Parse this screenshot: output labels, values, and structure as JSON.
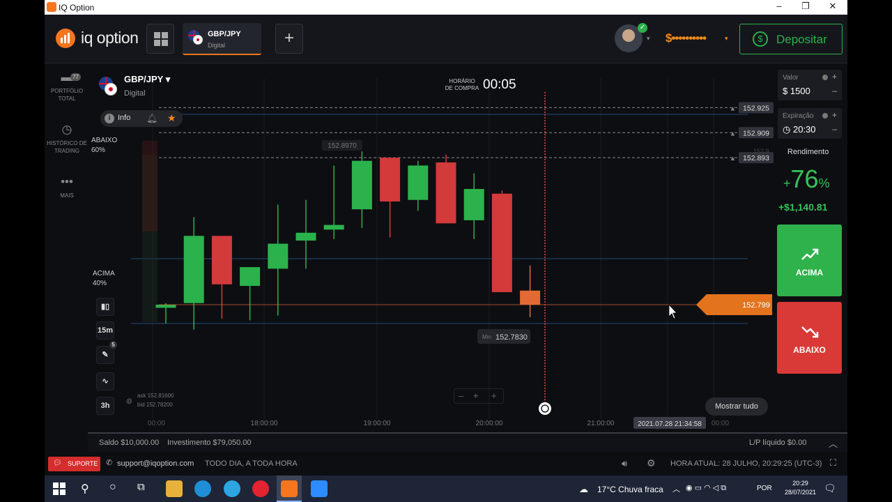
{
  "window": {
    "title": "IQ Option",
    "buttons": [
      "–",
      "❐",
      "✕"
    ]
  },
  "header": {
    "brand": "iq option",
    "asset_tab": {
      "name": "GBP/JPY",
      "type": "Digital"
    },
    "add_label": "+",
    "balance_masked": "$••••••••••",
    "deposit_label": "Depositar",
    "brand_color": "#f4761f",
    "accent_green": "#2bb24c"
  },
  "sidebar": {
    "items": [
      {
        "icon": "briefcase-icon",
        "label": "PORTFÓLIO TOTAL",
        "badge": "77"
      },
      {
        "icon": "history-icon",
        "label": "HISTÓRICO DE TRADING"
      },
      {
        "icon": "more-icon",
        "label": "MAIS"
      }
    ]
  },
  "chart_header": {
    "asset": "GBP/JPY",
    "type": "Digital",
    "info_label": "Info",
    "purchase_time_label": "HORÁRIO DE COMPRA",
    "purchase_timer": "00:05"
  },
  "sentiment": {
    "below_label": "ABAIXO",
    "below_pct": "60%",
    "above_label": "ACIMA",
    "above_pct": "40%"
  },
  "tools": {
    "timeframe": "15m",
    "pencil_badge": "5",
    "period": "3h"
  },
  "quotes": {
    "ask": "ask 152.81600",
    "bid": "bid 152.78200"
  },
  "chart_data": {
    "type": "candlestick",
    "x_ticks": [
      "18:00:00",
      "19:00:00",
      "20:00:00",
      "21:00:00",
      "2021.07.28 21:34:58"
    ],
    "x_edge_labels": [
      "00:00",
      "00:00"
    ],
    "ylim": [
      152.77,
      152.935
    ],
    "strike_levels": [
      152.925,
      152.909,
      152.893
    ],
    "current_price": "152.799",
    "max_label": "152.8970",
    "min_label_prefix": "Min",
    "min_label": "152.7830",
    "faded_level": "152.9",
    "candles": [
      {
        "o": 152.797,
        "h": 152.8,
        "l": 152.787,
        "c": 152.799
      },
      {
        "o": 152.8,
        "h": 152.855,
        "l": 152.783,
        "c": 152.843
      },
      {
        "o": 152.843,
        "h": 152.843,
        "l": 152.79,
        "c": 152.812
      },
      {
        "o": 152.811,
        "h": 152.823,
        "l": 152.789,
        "c": 152.823
      },
      {
        "o": 152.822,
        "h": 152.863,
        "l": 152.792,
        "c": 152.838
      },
      {
        "o": 152.84,
        "h": 152.866,
        "l": 152.822,
        "c": 152.845
      },
      {
        "o": 152.847,
        "h": 152.888,
        "l": 152.841,
        "c": 152.85
      },
      {
        "o": 152.86,
        "h": 152.897,
        "l": 152.848,
        "c": 152.891
      },
      {
        "o": 152.893,
        "h": 152.893,
        "l": 152.842,
        "c": 152.865
      },
      {
        "o": 152.866,
        "h": 152.891,
        "l": 152.859,
        "c": 152.888
      },
      {
        "o": 152.89,
        "h": 152.895,
        "l": 152.852,
        "c": 152.851
      },
      {
        "o": 152.853,
        "h": 152.883,
        "l": 152.841,
        "c": 152.873
      },
      {
        "o": 152.87,
        "h": 152.872,
        "l": 152.809,
        "c": 152.807
      },
      {
        "o": 152.808,
        "h": 152.824,
        "l": 152.791,
        "c": 152.799
      }
    ],
    "grid": true,
    "up_color": "#2bb24c",
    "down_color": "#d33a3a"
  },
  "chart_controls": {
    "zoom_out": "–",
    "zoom_in": "+",
    "show_all": "Mostrar tudo"
  },
  "trade_panel": {
    "value_label": "Valor",
    "value": "$ 1500",
    "expiry_label": "Expiração",
    "expiry": "20:30",
    "yield_label": "Rendimento",
    "yield_sign": "+",
    "yield_value": "76",
    "yield_pct": "%",
    "profit": "+$1,140.81",
    "up_label": "ACIMA",
    "down_label": "ABAIXO"
  },
  "footer": {
    "saldo": "Saldo $10,000.00",
    "investimento": "Investimento $79,050.00",
    "pl": "L/P líquido $0.00",
    "support_btn": "SUPORTE",
    "support_email": "support@iqoption.com",
    "hours": "TODO DIA, A TODA HORA",
    "clock": "HORA ATUAL: 28 JULHO, 20:29:25 (UTC-3)"
  },
  "taskbar": {
    "weather": "17°C  Chuva fraca",
    "lang": "POR",
    "time": "20:29",
    "date": "28/07/2021"
  }
}
